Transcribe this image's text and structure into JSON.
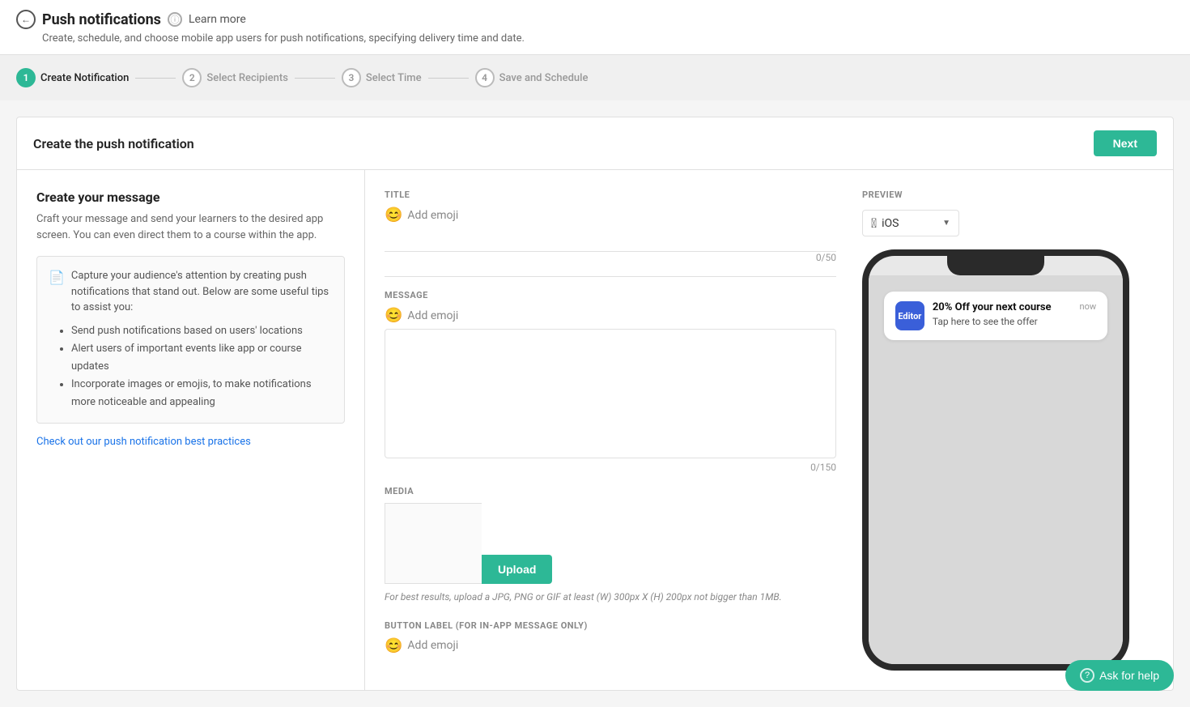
{
  "page": {
    "title": "Push notifications",
    "subtitle": "Create, schedule, and choose mobile app users for push notifications, specifying delivery time and date.",
    "learn_more": "Learn more"
  },
  "stepper": {
    "steps": [
      {
        "number": "1",
        "label": "Create Notification",
        "active": true
      },
      {
        "number": "2",
        "label": "Select Recipients",
        "active": false
      },
      {
        "number": "3",
        "label": "Select Time",
        "active": false
      },
      {
        "number": "4",
        "label": "Save and Schedule",
        "active": false
      }
    ]
  },
  "section": {
    "title": "Create the push notification",
    "next_btn": "Next"
  },
  "left_panel": {
    "create_msg_title": "Create your message",
    "create_msg_subtitle": "Craft your message and send your learners to the desired app screen. You can even direct them to a course within the app.",
    "tips_intro": "Capture your audience's attention by creating push notifications that stand out. Below are some useful tips to assist you:",
    "tips": [
      "Send push notifications based on users' locations",
      "Alert users of important events like app or course updates",
      "Incorporate images or emojis, to make notifications more noticeable and appealing"
    ],
    "best_practices_link": "Check out our push notification best practices"
  },
  "form": {
    "title_label": "TITLE",
    "title_emoji": "😊",
    "title_add_emoji": "Add emoji",
    "title_char_count": "0/50",
    "message_label": "MESSAGE",
    "message_emoji": "😊",
    "message_add_emoji": "Add emoji",
    "message_char_count": "0/150",
    "media_label": "MEDIA",
    "upload_btn": "Upload",
    "media_hint": "For best results, upload a JPG, PNG or GIF at least (W) 300px X (H) 200px not bigger than 1MB.",
    "button_label_section": "BUTTON LABEL (FOR IN-APP MESSAGE ONLY)",
    "button_label_emoji": "😊",
    "button_add_emoji": "Add emoji"
  },
  "preview": {
    "label": "PREVIEW",
    "platform": "iOS",
    "platform_icon": "",
    "notification": {
      "app_icon_text": "Editor",
      "title": "20% Off your next course",
      "body": "Tap here to see the offer",
      "time": "now"
    }
  },
  "help": {
    "btn_label": "Ask for help"
  }
}
